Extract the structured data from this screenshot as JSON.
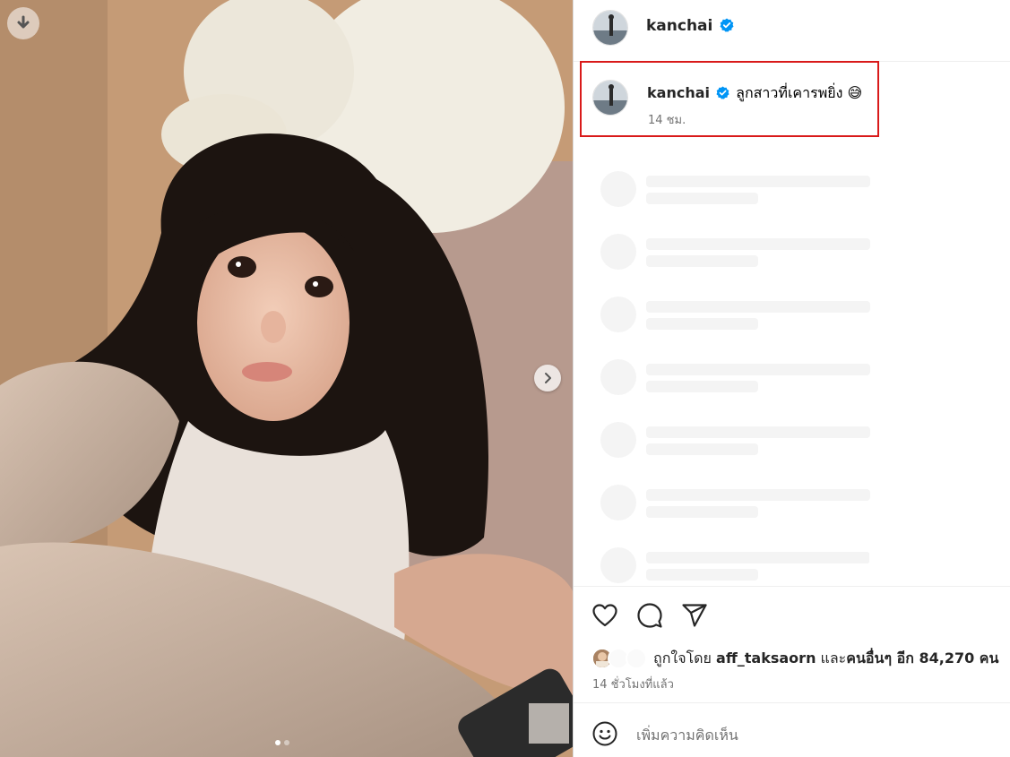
{
  "post": {
    "username": "kanchai",
    "verified": true,
    "caption": "ลูกสาวที่เคารพยิ่ง",
    "caption_emoji": "😅",
    "caption_time": "14 ชม.",
    "image_count": 2,
    "current_image": 1
  },
  "icons": {
    "download": "download-arrow-icon",
    "next": "chevron-right-icon",
    "verified": "verified-badge-icon",
    "like": "heart-icon",
    "comment": "comment-bubble-icon",
    "share": "paper-plane-icon",
    "emoji": "smiley-icon"
  },
  "likes": {
    "prefix": "ถูกใจโดย ",
    "liker": "aff_taksaorn",
    "middle": " และ",
    "others": "คนอื่นๆ อีก 84,270 คน"
  },
  "posted_time": "14 ชั่วโมงที่แล้ว",
  "comment": {
    "placeholder": "เพิ่มความคิดเห็น"
  },
  "colors": {
    "verified_blue": "#0095f6",
    "highlight_red": "#d91a1a",
    "muted_text": "#737373",
    "skeleton": "#f4f4f4"
  }
}
